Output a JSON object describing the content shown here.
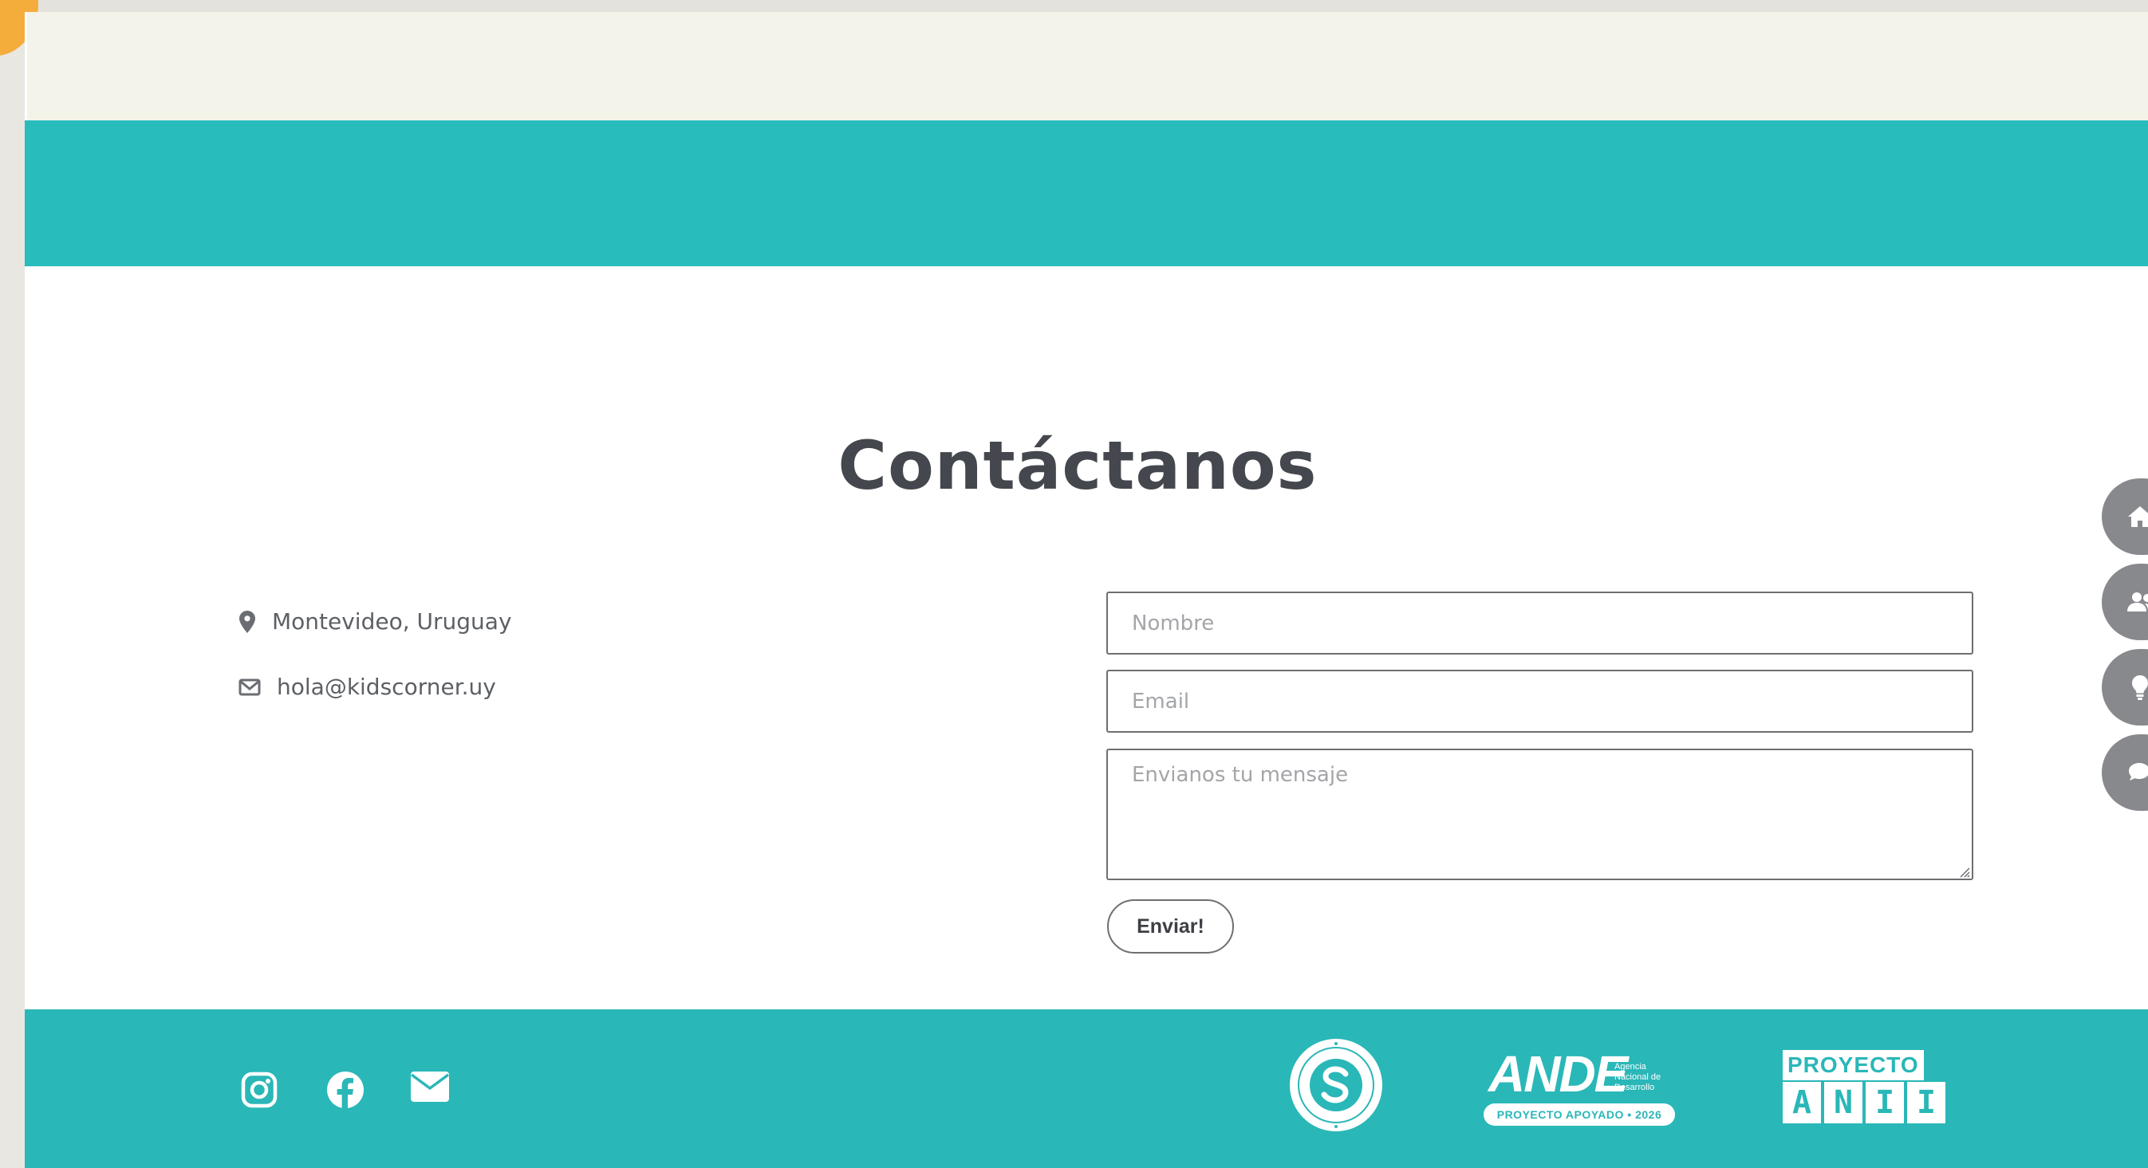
{
  "contact": {
    "title": "Contáctanos",
    "location": "Montevideo, Uruguay",
    "email": "hola@kidscorner.uy"
  },
  "form": {
    "name_placeholder": "Nombre",
    "email_placeholder": "Email",
    "message_placeholder": "Envianos tu mensaje",
    "submit_label": "Enviar!"
  },
  "footer": {
    "social_icons": [
      "instagram-icon",
      "facebook-icon",
      "envelope-icon"
    ],
    "logos": {
      "ande_word": "ANDE",
      "ande_subtitle": "Agencia Nacional de Desarrollo",
      "ande_badge": "PROYECTO APOYADO • 2026",
      "anii_top": "PROYECTO",
      "anii_letters": [
        "A",
        "N",
        "I",
        "I"
      ]
    }
  },
  "side_nav": {
    "icons": [
      "home-icon",
      "users-icon",
      "lightbulb-icon",
      "chat-icon"
    ]
  },
  "colors": {
    "teal": "#29bcbd",
    "cream": "#f4f3ea",
    "heading": "#44474d",
    "side_button": "#88898d",
    "accent_orange": "#f4ac3b"
  }
}
